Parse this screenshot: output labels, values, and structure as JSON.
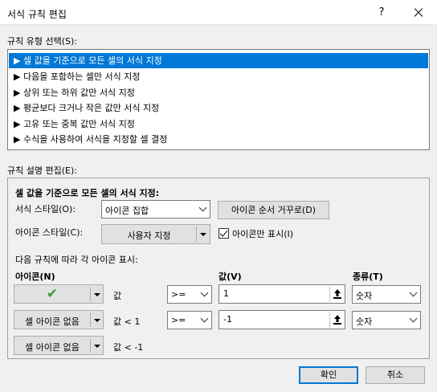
{
  "window": {
    "title": "서식 규칙 편집",
    "help": "?"
  },
  "rule_type": {
    "label": "규칙 유형 선택(S):",
    "items": [
      "▶ 셀 값을 기준으로 모든 셀의 서식 지정",
      "▶ 다음을 포함하는 셀만 서식 지정",
      "▶ 상위 또는 하위 값만 서식 지정",
      "▶ 평균보다 크거나 작은 값만 서식 지정",
      "▶ 고유 또는 중복 값만 서식 지정",
      "▶ 수식을 사용하여 서식을 지정할 셀 결정"
    ],
    "selected_index": 0
  },
  "description": {
    "label": "규칙 설명 편집(E):",
    "heading": "셀 값을 기준으로 모든 셀의 서식 지정:",
    "format_style_label": "서식 스타일(O):",
    "format_style_value": "아이콘 집합",
    "reverse_order_button": "아이콘 순서 거꾸로(D)",
    "icon_style_label": "아이콘 스타일(C):",
    "icon_style_value": "사용자 지정",
    "icon_only_label": "아이콘만 표시(I)",
    "icon_only_checked": true,
    "rules_label": "다음 규칙에 따라 각 아이콘 표시:",
    "col_icon": "아이콘(N)",
    "col_value": "값(V)",
    "col_type": "종류(T)",
    "rows": [
      {
        "icon": "✔",
        "icon_name": "green-check-icon",
        "condition": "값",
        "operator": ">=",
        "value": "1",
        "type": "숫자"
      },
      {
        "icon": "셀 아이콘 없음",
        "condition": "값 < 1",
        "operator": ">=",
        "value": "-1",
        "type": "숫자"
      },
      {
        "icon": "셀 아이콘 없음",
        "condition": "값 < -1"
      }
    ]
  },
  "buttons": {
    "ok": "확인",
    "cancel": "취소"
  },
  "colors": {
    "selection": "#0078d7",
    "check": "#3a9c3a"
  }
}
